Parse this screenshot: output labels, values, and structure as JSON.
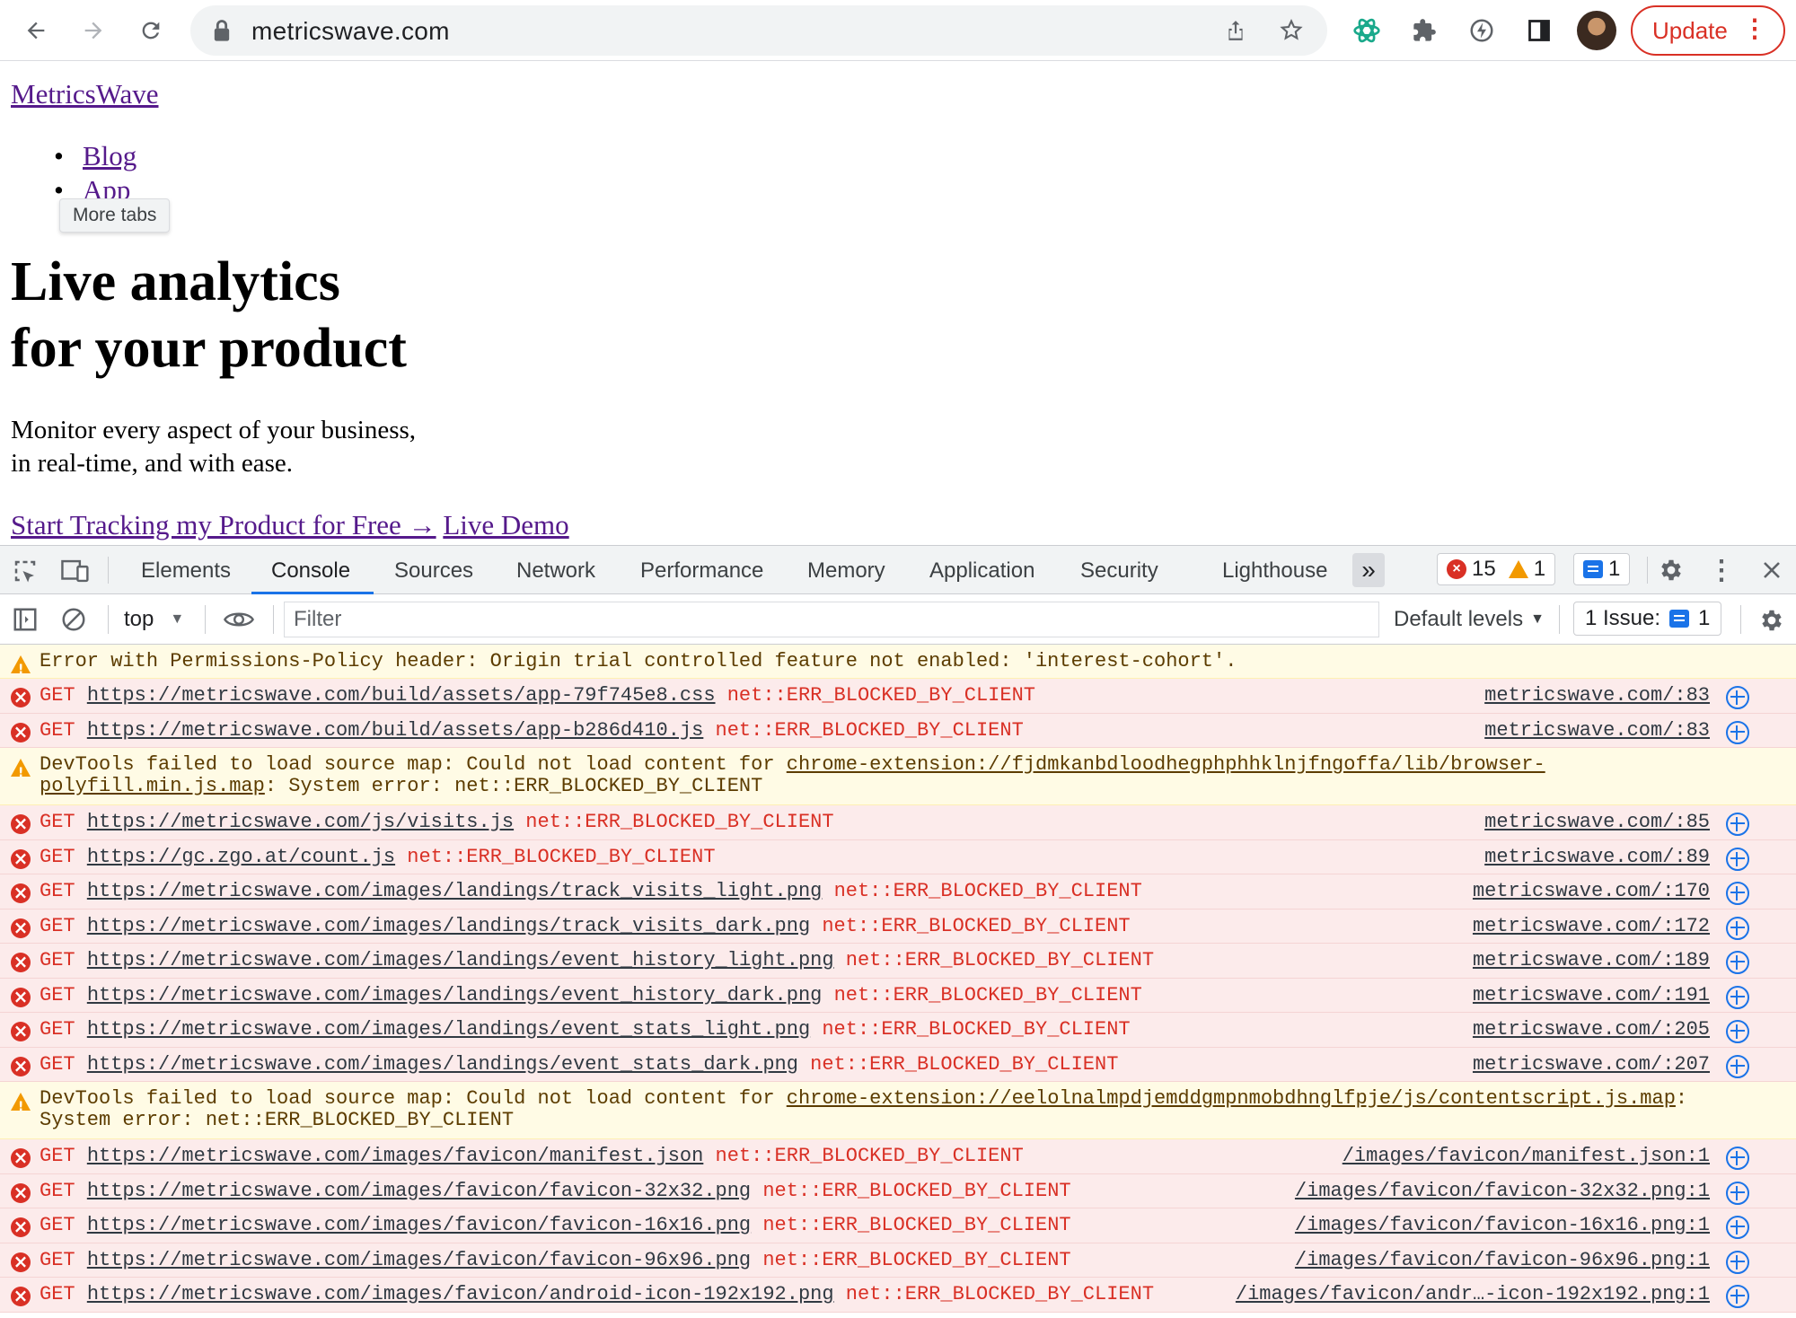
{
  "browser": {
    "url": "metricswave.com",
    "update_label": "Update",
    "icons": [
      "back-icon",
      "forward-icon",
      "reload-icon",
      "lock-icon",
      "share-icon",
      "bookmark-star-icon",
      "extension-atom-icon",
      "puzzle-extensions-icon",
      "extension-bolt-icon",
      "side-panel-icon",
      "profile-avatar",
      "more-menu-icon"
    ]
  },
  "page": {
    "brand": "MetricsWave",
    "nav": [
      "Blog",
      "App"
    ],
    "tooltip": "More tabs",
    "hero_line1": "Live analytics",
    "hero_line2": "for your product",
    "sub_line1": "Monitor every aspect of your business,",
    "sub_line2": "in real-time, and with ease.",
    "cta_primary": "Start Tracking my Product for Free →",
    "cta_secondary": "Live Demo"
  },
  "devtools": {
    "tabs": [
      "Elements",
      "Console",
      "Sources",
      "Network",
      "Performance",
      "Memory",
      "Application",
      "Security",
      "Lighthouse"
    ],
    "active_tab": "Console",
    "error_count": "15",
    "warning_count": "1",
    "message_count": "1",
    "context": "top",
    "filter_placeholder": "Filter",
    "levels": "Default levels",
    "issues_label": "1 Issue:",
    "issues_count": "1"
  },
  "console": {
    "warn1": "Error with Permissions-Policy header: Origin trial controlled feature not enabled: 'interest-cohort'.",
    "method": "GET",
    "blocked": "net::ERR_BLOCKED_BY_CLIENT",
    "sm_prefix": "DevTools failed to load source map: Could not load content for ",
    "sm_suffix": ": System error: net::ERR_BLOCKED_BY_CLIENT",
    "sm1_url": "chrome-extension://fjdmkanbdloodhegphphhklnjfngoffa/lib/browser-polyfill.min.js.map",
    "sm2_url": "chrome-extension://eelolnalmpdjemddgmpnmobdhnglfpje/js/contentscript.js.map",
    "rows": [
      {
        "url": "https://metricswave.com/build/assets/app-79f745e8.css",
        "src": "metricswave.com/:83"
      },
      {
        "url": "https://metricswave.com/build/assets/app-b286d410.js",
        "src": "metricswave.com/:83"
      },
      {
        "url": "https://metricswave.com/js/visits.js",
        "src": "metricswave.com/:85"
      },
      {
        "url": "https://gc.zgo.at/count.js",
        "src": "metricswave.com/:89"
      },
      {
        "url": "https://metricswave.com/images/landings/track_visits_light.png",
        "src": "metricswave.com/:170"
      },
      {
        "url": "https://metricswave.com/images/landings/track_visits_dark.png",
        "src": "metricswave.com/:172"
      },
      {
        "url": "https://metricswave.com/images/landings/event_history_light.png",
        "src": "metricswave.com/:189"
      },
      {
        "url": "https://metricswave.com/images/landings/event_history_dark.png",
        "src": "metricswave.com/:191"
      },
      {
        "url": "https://metricswave.com/images/landings/event_stats_light.png",
        "src": "metricswave.com/:205"
      },
      {
        "url": "https://metricswave.com/images/landings/event_stats_dark.png",
        "src": "metricswave.com/:207"
      },
      {
        "url": "https://metricswave.com/images/favicon/manifest.json",
        "src": "/images/favicon/manifest.json:1"
      },
      {
        "url": "https://metricswave.com/images/favicon/favicon-32x32.png",
        "src": "/images/favicon/favicon-32x32.png:1"
      },
      {
        "url": "https://metricswave.com/images/favicon/favicon-16x16.png",
        "src": "/images/favicon/favicon-16x16.png:1"
      },
      {
        "url": "https://metricswave.com/images/favicon/favicon-96x96.png",
        "src": "/images/favicon/favicon-96x96.png:1"
      },
      {
        "url": "https://metricswave.com/images/favicon/android-icon-192x192.png",
        "src": "/images/favicon/andr…-icon-192x192.png:1"
      }
    ]
  }
}
